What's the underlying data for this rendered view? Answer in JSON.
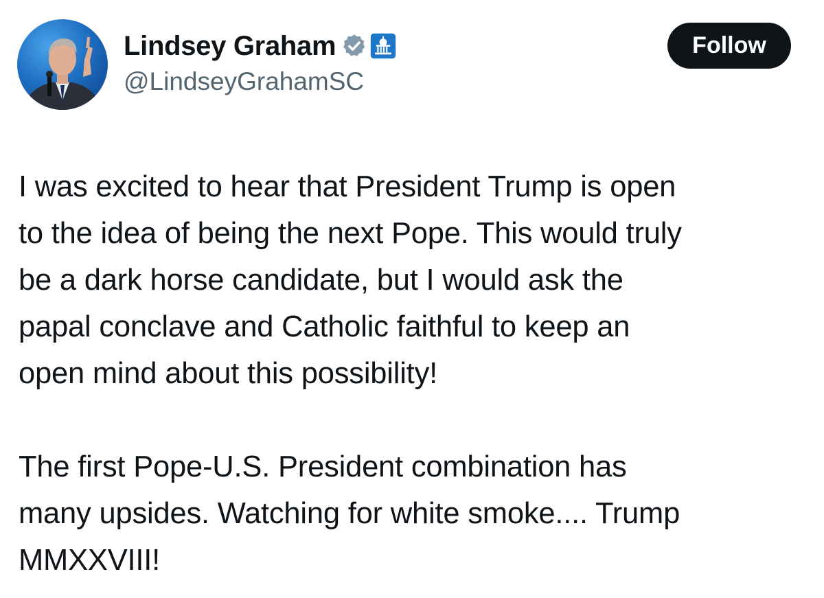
{
  "author": {
    "display_name": "Lindsey Graham",
    "handle": "@LindseyGrahamSC",
    "verified_icon": "verified-badge-icon",
    "affiliation_icon": "government-building-icon",
    "accent_color": "#1d9bf0"
  },
  "actions": {
    "follow_label": "Follow"
  },
  "tweet": {
    "paragraph_1_lines": [
      "I was excited to hear that President Trump is open",
      "to the idea of being the next Pope. This would truly",
      "be a dark horse candidate, but I would ask the",
      "papal conclave and Catholic faithful to keep an",
      "open mind about this possibility!"
    ],
    "paragraph_2_lines": [
      "The first Pope-U.S. President combination has",
      "many upsides. Watching for white smoke.... Trump",
      "MMXXVIII!"
    ]
  }
}
